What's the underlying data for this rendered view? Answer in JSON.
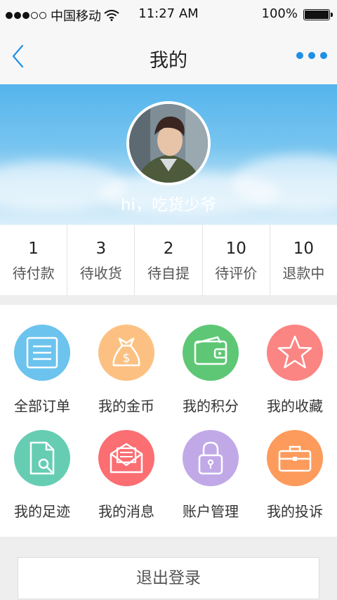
{
  "status_bar": {
    "carrier": "中国移动",
    "time": "11:27 AM",
    "battery": "100%",
    "signal_bars": 3,
    "signal_total": 5
  },
  "nav": {
    "title": "我的"
  },
  "profile": {
    "greeting": "hi，吃货少爷"
  },
  "orders": [
    {
      "count": "1",
      "label": "待付款"
    },
    {
      "count": "3",
      "label": "待收货"
    },
    {
      "count": "2",
      "label": "待自提"
    },
    {
      "count": "10",
      "label": "待评价"
    },
    {
      "count": "10",
      "label": "退款中"
    }
  ],
  "menu": [
    {
      "label": "全部订单",
      "icon": "order-list-icon",
      "color": "#6cc3ee"
    },
    {
      "label": "我的金币",
      "icon": "money-bag-icon",
      "color": "#fcc182"
    },
    {
      "label": "我的积分",
      "icon": "wallet-icon",
      "color": "#5ec775"
    },
    {
      "label": "我的收藏",
      "icon": "star-icon",
      "color": "#fb8582"
    },
    {
      "label": "我的足迹",
      "icon": "document-search-icon",
      "color": "#66cdb3"
    },
    {
      "label": "我的消息",
      "icon": "envelope-icon",
      "color": "#fb6e72"
    },
    {
      "label": "账户管理",
      "icon": "lock-icon",
      "color": "#c1a9e8"
    },
    {
      "label": "我的投诉",
      "icon": "briefcase-icon",
      "color": "#fd9b5c"
    }
  ],
  "logout_label": "退出登录",
  "colors": {
    "accent": "#1f8fe5",
    "banner_top": "#55b4ec",
    "banner_bottom": "#d9eefa"
  }
}
